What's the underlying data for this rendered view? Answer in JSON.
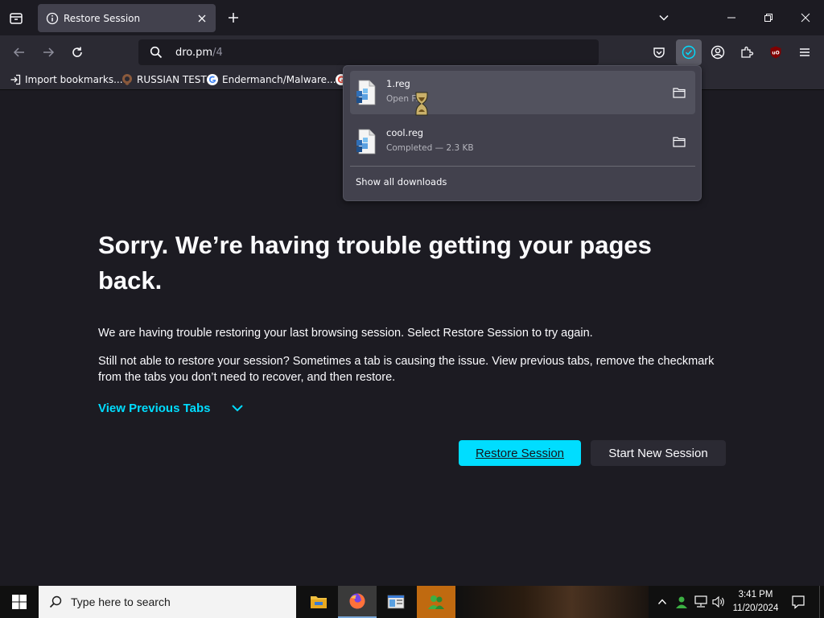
{
  "tab": {
    "title": "Restore Session"
  },
  "url": {
    "host": "dro.pm",
    "path": "/4"
  },
  "bookmarks": [
    {
      "label": "Import bookmarks..."
    },
    {
      "label": "RUSSIAN TEST"
    },
    {
      "label": "Endermanch/Malware..."
    }
  ],
  "downloads": {
    "items": [
      {
        "name": "1.reg",
        "status": "Open File"
      },
      {
        "name": "cool.reg",
        "status": "Completed — 2.3 KB"
      }
    ],
    "show_all": "Show all downloads"
  },
  "page": {
    "heading": "Sorry. We’re having trouble getting your pages back.",
    "para1": "We are having trouble restoring your last browsing session. Select Restore Session to try again.",
    "para2": "Still not able to restore your session? Sometimes a tab is causing the issue. View previous tabs, remove the checkmark from the tabs you don’t need to recover, and then restore.",
    "view_previous": "View Previous Tabs",
    "restore_btn": "Restore Session",
    "new_session_btn": "Start New Session"
  },
  "taskbar": {
    "search_placeholder": "Type here to search",
    "time": "3:41 PM",
    "date": "11/20/2024"
  },
  "colors": {
    "accent": "#00ddff",
    "bg": "#1c1b22",
    "toolbar": "#2b2a33"
  }
}
